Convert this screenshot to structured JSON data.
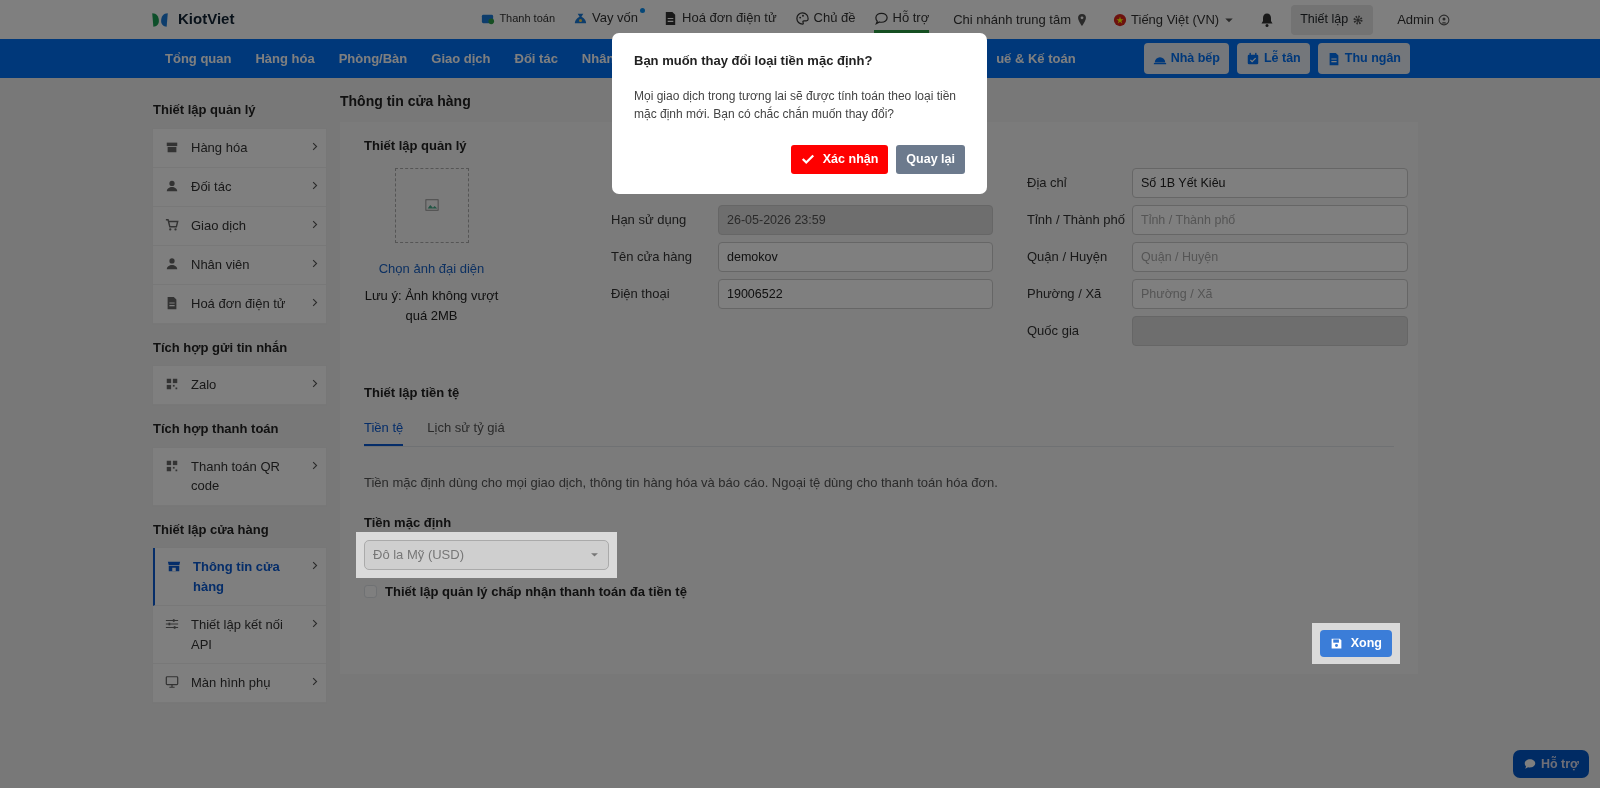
{
  "top_bar": {
    "logo": "KiotViet",
    "links": [
      {
        "label": "Thanh toán",
        "selected": false,
        "dot": false
      },
      {
        "label": "Vay vốn",
        "selected": false,
        "dot": true
      },
      {
        "label": "Hoá đơn điện tử",
        "selected": false,
        "dot": false
      },
      {
        "label": "Chủ đề",
        "selected": false,
        "dot": false
      },
      {
        "label": "Hỗ trợ",
        "selected": true,
        "dot": false
      }
    ],
    "branch": "Chi nhánh trung tâm",
    "language": "Tiếng Việt (VN)",
    "settings": "Thiết lập",
    "user": "Admin"
  },
  "nav": {
    "items": [
      "Tổng quan",
      "Hàng hóa",
      "Phòng/Bàn",
      "Giao dịch",
      "Đối tác",
      "Nhân"
    ],
    "tail_item": "uế & Kế toán",
    "buttons": [
      "Nhà bếp",
      "Lễ tân",
      "Thu ngân"
    ]
  },
  "sidebar": {
    "groups": [
      {
        "title": "Thiết lập quản lý",
        "items": [
          {
            "label": "Hàng hóa",
            "selected": false
          },
          {
            "label": "Đối tác",
            "selected": false
          },
          {
            "label": "Giao dịch",
            "selected": false
          },
          {
            "label": "Nhân viên",
            "selected": false
          },
          {
            "label": "Hoá đơn điện tử",
            "selected": false
          }
        ]
      },
      {
        "title": "Tích hợp gửi tin nhắn",
        "items": [
          {
            "label": "Zalo",
            "selected": false
          }
        ]
      },
      {
        "title": "Tích hợp thanh toán",
        "items": [
          {
            "label": "Thanh toán QR code",
            "selected": false
          }
        ]
      },
      {
        "title": "Thiết lập cửa hàng",
        "items": [
          {
            "label": "Thông tin cửa hàng",
            "selected": true
          },
          {
            "label": "Thiết lập kết nối API",
            "selected": false
          },
          {
            "label": "Màn hình phụ",
            "selected": false
          }
        ]
      }
    ]
  },
  "page_title": "Thông tin cửa hàng",
  "store": {
    "title": "Thiết lập quản lý",
    "avatar_link": "Chọn ảnh đại diện",
    "avatar_note": "Lưu ý: Ảnh không vượt quá 2MB",
    "fields_left": [
      {
        "label": "Hạn sử dụng",
        "value": "26-05-2026 23:59",
        "disabled": true
      },
      {
        "label": "Tên cửa hàng",
        "value": "demokov",
        "disabled": false
      },
      {
        "label": "Điện thoại",
        "value": "19006522",
        "disabled": false
      }
    ],
    "fields_right": [
      {
        "label": "Địa chỉ",
        "value": "Số 1B Yết Kiêu",
        "disabled": false
      },
      {
        "label": "Tỉnh / Thành phố",
        "placeholder": "Tỉnh / Thành phố",
        "disabled": false
      },
      {
        "label": "Quận / Huyện",
        "placeholder": "Quận / Huyện",
        "disabled": false
      },
      {
        "label": "Phường / Xã",
        "placeholder": "Phường / Xã",
        "disabled": false
      },
      {
        "label": "Quốc gia",
        "disabled": true
      }
    ]
  },
  "currency": {
    "title": "Thiết lập tiền tệ",
    "tabs": [
      {
        "label": "Tiền tệ",
        "selected": true
      },
      {
        "label": "Lịch sử tỷ giá",
        "selected": false
      }
    ],
    "description": "Tiền mặc định dùng cho mọi giao dịch, thông tin hàng hóa và báo cáo. Ngoại tệ dùng cho thanh toán hóa đơn.",
    "default_label": "Tiền mặc định",
    "default_value": "Đô la Mỹ (USD)",
    "multi_currency": {
      "label": "Thiết lập quản lý chấp nhận thanh toán đa tiền tệ",
      "checked": false
    }
  },
  "done_button": "Xong",
  "modal": {
    "title": "Bạn muốn thay đổi loại tiền mặc định?",
    "body": "Mọi giao dịch trong tương lai sẽ được tính toán theo loại tiền mặc định mới. Bạn có chắc chắn muốn thay đổi?",
    "confirm": "Xác nhận",
    "cancel": "Quay lại"
  },
  "help_button": "Hỗ trợ"
}
